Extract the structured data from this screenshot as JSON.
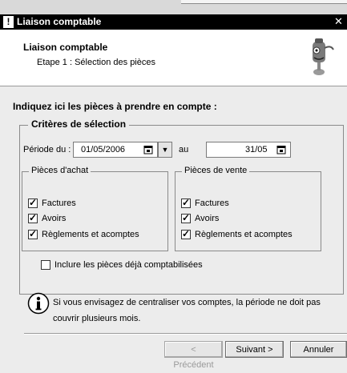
{
  "window": {
    "title": "Liaison comptable",
    "close_glyph": "✕"
  },
  "header": {
    "title": "Liaison comptable",
    "subtitle": "Etape 1 : Sélection des pièces",
    "mascot_icon": "wizard-mascot-icon"
  },
  "instruction": "Indiquez ici les pièces à prendre en compte :",
  "criteria": {
    "legend": "Critères de sélection",
    "period_label": "Période du :",
    "date_from": "01/05/2006",
    "to_label": "au",
    "date_to": "31/05",
    "purchase": {
      "legend": "Pièces d'achat",
      "items": [
        {
          "label": "Factures",
          "checked": true
        },
        {
          "label": "Avoirs",
          "checked": true
        },
        {
          "label": "Règlements et acomptes",
          "checked": true
        }
      ]
    },
    "sales": {
      "legend": "Pièces de vente",
      "items": [
        {
          "label": "Factures",
          "checked": true
        },
        {
          "label": "Avoirs",
          "checked": true
        },
        {
          "label": "Règlements et acomptes",
          "checked": true
        }
      ]
    },
    "include_accounted": {
      "label": "Inclure les pièces déjà comptabilisées",
      "checked": false
    }
  },
  "info": {
    "icon": "info-icon",
    "text": "Si vous envisagez de centraliser vos comptes, la période ne doit pas couvrir plusieurs mois."
  },
  "buttons": {
    "previous": "< Précédent",
    "next": "Suivant >",
    "cancel": "Annuler"
  }
}
